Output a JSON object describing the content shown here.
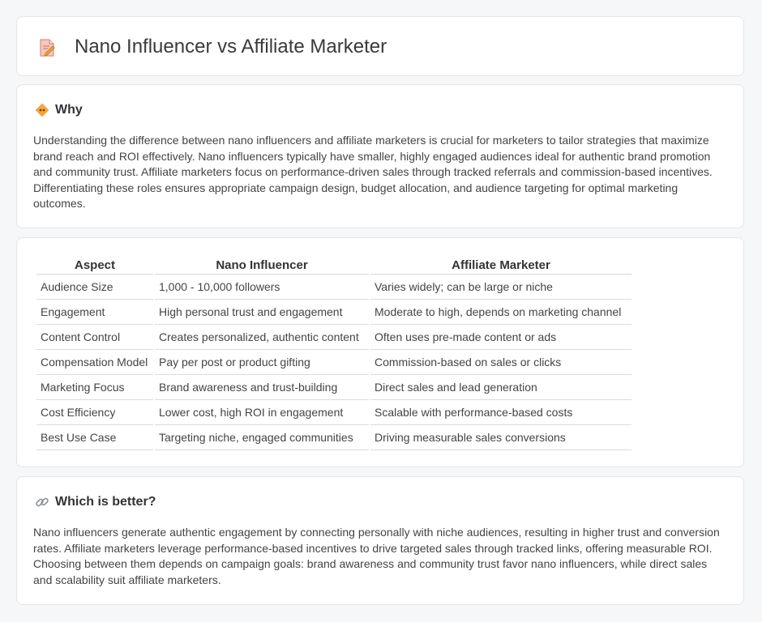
{
  "header": {
    "title": "Nano Influencer vs Affiliate Marketer",
    "icon": "document-pencil-icon"
  },
  "why": {
    "heading": "Why",
    "icon": "diamond-warning-icon",
    "text": "Understanding the difference between nano influencers and affiliate marketers is crucial for marketers to tailor strategies that maximize brand reach and ROI effectively. Nano influencers typically have smaller, highly engaged audiences ideal for authentic brand promotion and community trust. Affiliate marketers focus on performance-driven sales through tracked referrals and commission-based incentives. Differentiating these roles ensures appropriate campaign design, budget allocation, and audience targeting for optimal marketing outcomes."
  },
  "table": {
    "columns": [
      "Aspect",
      "Nano Influencer",
      "Affiliate Marketer"
    ],
    "rows": [
      [
        "Audience Size",
        "1,000 - 10,000 followers",
        "Varies widely; can be large or niche"
      ],
      [
        "Engagement",
        "High personal trust and engagement",
        "Moderate to high, depends on marketing channel"
      ],
      [
        "Content Control",
        "Creates personalized, authentic content",
        "Often uses pre-made content or ads"
      ],
      [
        "Compensation Model",
        "Pay per post or product gifting",
        "Commission-based on sales or clicks"
      ],
      [
        "Marketing Focus",
        "Brand awareness and trust-building",
        "Direct sales and lead generation"
      ],
      [
        "Cost Efficiency",
        "Lower cost, high ROI in engagement",
        "Scalable with performance-based costs"
      ],
      [
        "Best Use Case",
        "Targeting niche, engaged communities",
        "Driving measurable sales conversions"
      ]
    ]
  },
  "better": {
    "heading": "Which is better?",
    "icon": "link-icon",
    "text": "Nano influencers generate authentic engagement by connecting personally with niche audiences, resulting in higher trust and conversion rates. Affiliate marketers leverage performance-based incentives to drive targeted sales through tracked links, offering measurable ROI. Choosing between them depends on campaign goals: brand awareness and community trust favor nano influencers, while direct sales and scalability suit affiliate marketers."
  },
  "colors": {
    "background": "#f6f7f9",
    "card": "#ffffff",
    "accent_orange": "#f4a63a",
    "icon_pink": "#e8806b"
  }
}
